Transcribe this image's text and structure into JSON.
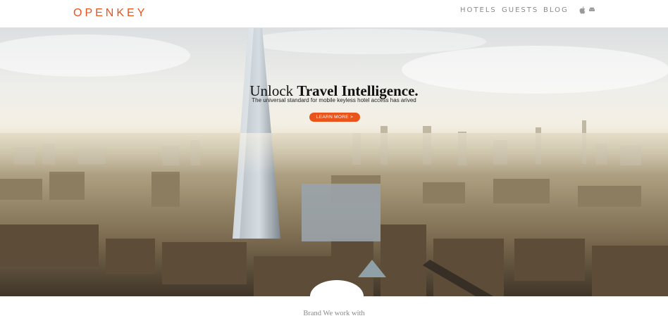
{
  "header": {
    "logo_text": "OPENKEY",
    "nav": [
      {
        "label": "HOTELS"
      },
      {
        "label": "GUESTS"
      },
      {
        "label": "BLOG"
      }
    ],
    "platform_icons": [
      "apple-icon",
      "android-icon"
    ]
  },
  "hero": {
    "title_light": "Unlock ",
    "title_bold": "Travel Intelligence.",
    "subtitle": "The universal standard for mobile keyless hotel access has arived",
    "cta_label": "LEARN MORE >",
    "background": "city-skyline-photo"
  },
  "brands": {
    "caption": "Brand We work with"
  },
  "colors": {
    "accent": "#e8541c",
    "nav_text": "#8a8a8a"
  }
}
